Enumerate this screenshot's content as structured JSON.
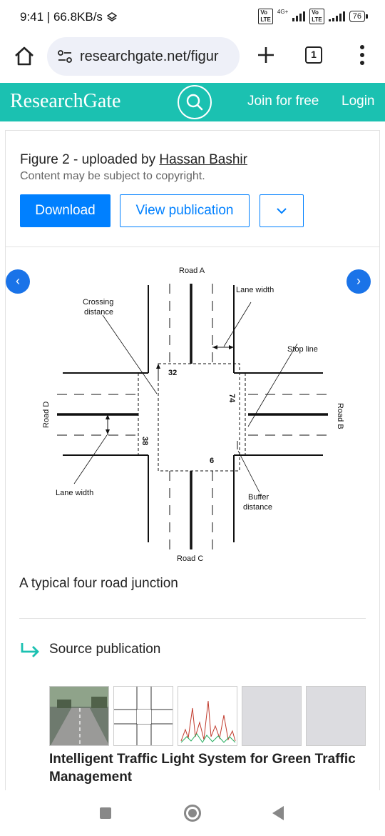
{
  "status_bar": {
    "time_and_speed": "9:41 | 66.8KB/s",
    "network_type": "4G+",
    "volte_label": "Vo LTE",
    "battery": "76"
  },
  "browser": {
    "url": "researchgate.net/figur",
    "tab_count": "1"
  },
  "rg_header": {
    "logo": "ResearchGate",
    "join_label": "Join for free",
    "login_label": "Login",
    "accent_color": "#1bc1b1"
  },
  "figure_card": {
    "heading_prefix": "Figure 2 - uploaded by ",
    "uploader": "Hassan Bashir",
    "copyright_note": "Content may be subject to copyright.",
    "download_label": "Download",
    "view_label": "View publication",
    "caption": "A typical four road junction",
    "primary_color": "#0080ff"
  },
  "diagram": {
    "road_a": "Road A",
    "road_b": "Road B",
    "road_c": "Road C",
    "road_d": "Road D",
    "crossing_distance_line1": "Crossing",
    "crossing_distance_line2": "distance",
    "lane_width_top": "Lane width",
    "lane_width_left": "Lane width",
    "stop_line": "Stop line",
    "buffer_line1": "Buffer",
    "buffer_line2": "distance",
    "dim_32": "32",
    "dim_74": "74",
    "dim_38": "38",
    "dim_6": "6"
  },
  "source": {
    "label": "Source publication",
    "publication_title": "Intelligent Traffic Light System for Green Traffic Management"
  }
}
